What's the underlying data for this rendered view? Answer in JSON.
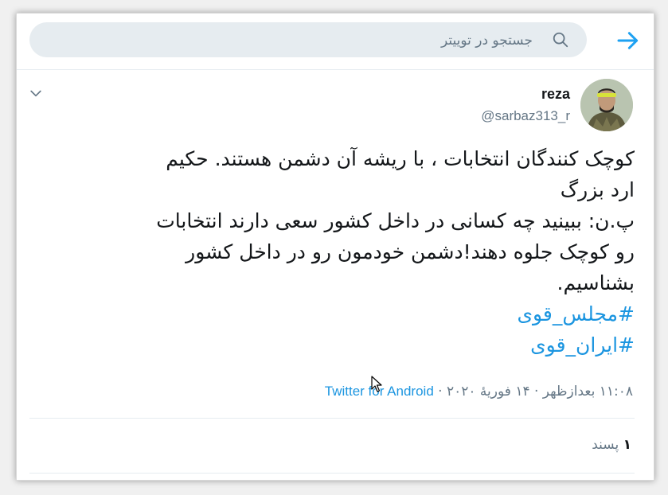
{
  "search": {
    "placeholder": "جستجو در توییتر",
    "value": ""
  },
  "header": {
    "back_icon": "arrow-right-icon",
    "search_icon": "search-icon"
  },
  "tweet": {
    "display_name": "reza",
    "handle": "@sarbaz313_r",
    "text_lines": [
      "کوچک کنندگان انتخابات ، با ریشه آن دشمن هستند. حکیم",
      "ارد بزرگ",
      "پ.ن: ببینید چه کسانی در داخل کشور سعی دارند انتخابات",
      "رو کوچک جلوه دهند!دشمن خودمون رو در داخل کشور",
      "بشناسیم."
    ],
    "hashtags": [
      "#مجلس_قوی",
      "#ایران_قوی"
    ],
    "timestamp": "۱۱:۰۸ بعدازظهر · ۱۴ فوریهٔ ۲۰۲۰ · ",
    "source": "Twitter for Android",
    "likes_count": "۱",
    "likes_label": "پسند",
    "menu_icon": "chevron-down-icon"
  },
  "colors": {
    "accent": "#1da1f2",
    "link": "#1b95e0",
    "muted": "#657786",
    "text": "#14171a",
    "search_bg": "#e6ecf0"
  }
}
